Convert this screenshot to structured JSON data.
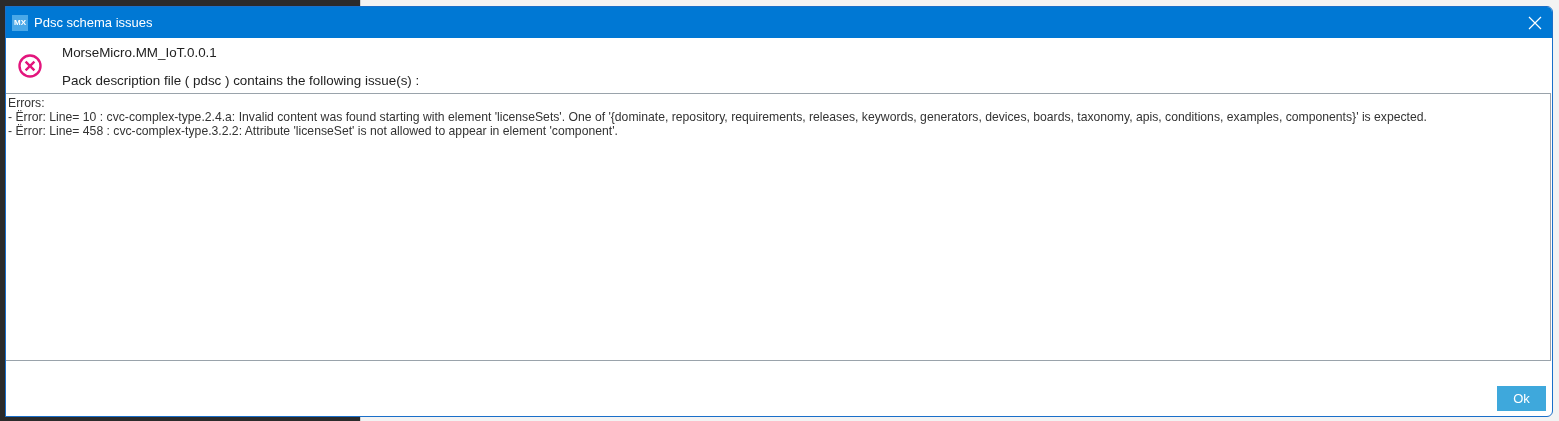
{
  "window": {
    "title": "Pdsc schema issues",
    "logo": "MX"
  },
  "header": {
    "pack_name": "MorseMicro.MM_IoT.0.0.1",
    "message": "Pack description file ( pdsc ) contains the following issue(s) :"
  },
  "issues": {
    "lines": [
      "Errors:",
      "- Ërror: Line= 10 : cvc-complex-type.2.4.a: Invalid content was found starting with element 'licenseSets'. One of '{dominate, repository, requirements, releases, keywords, generators, devices, boards, taxonomy, apis, conditions, examples, components}' is expected.",
      "- Ërror: Line= 458 : cvc-complex-type.3.2.2: Attribute 'licenseSet' is not allowed to appear in element 'component'."
    ]
  },
  "buttons": [
    {
      "label": "Ok"
    }
  ]
}
